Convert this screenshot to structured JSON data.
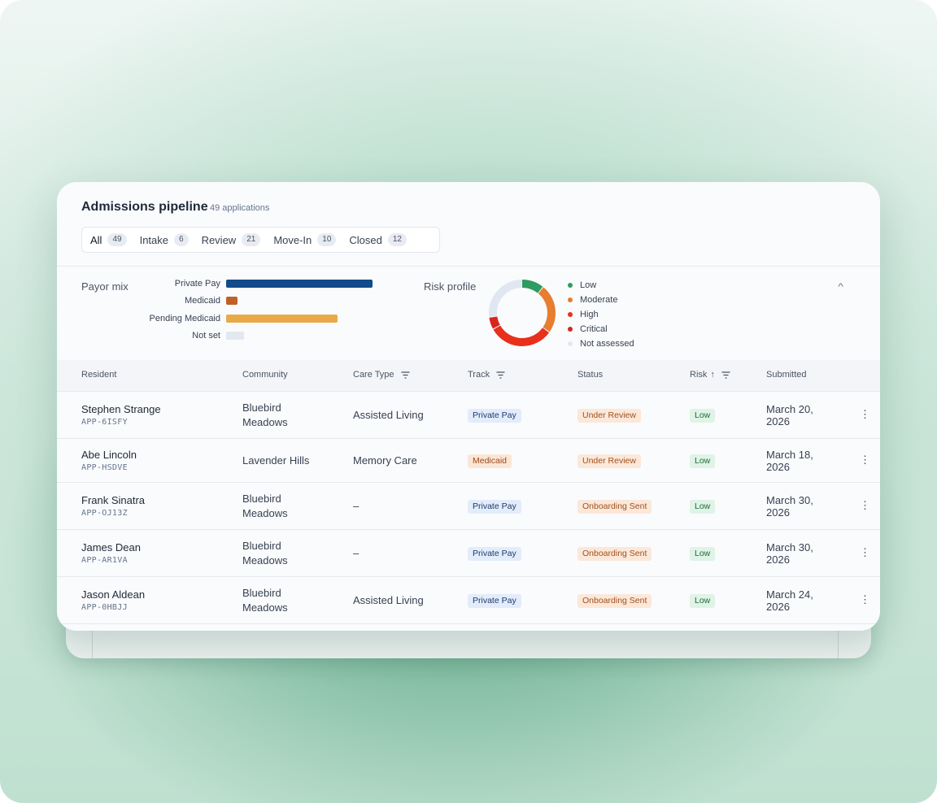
{
  "header": {
    "title": "Admissions pipeline",
    "count": "49 applications"
  },
  "tabs": [
    {
      "label": "All",
      "count": "49",
      "active": true
    },
    {
      "label": "Intake",
      "count": "6"
    },
    {
      "label": "Review",
      "count": "21"
    },
    {
      "label": "Move-In",
      "count": "10"
    },
    {
      "label": "Closed",
      "count": "12"
    }
  ],
  "payor": {
    "title": "Payor mix",
    "bars": [
      {
        "label": "Private Pay",
        "value": 1.0,
        "color": "#134a8a"
      },
      {
        "label": "Medicaid",
        "value": 0.08,
        "color": "#c25f26"
      },
      {
        "label": "Pending Medicaid",
        "value": 0.76,
        "color": "#eaa948"
      },
      {
        "label": "Not set",
        "value": 0.12,
        "color": "#e2e8f2"
      }
    ]
  },
  "risk": {
    "title": "Risk profile",
    "legend": [
      {
        "label": "Low",
        "color": "#2e9b60"
      },
      {
        "label": "Moderate",
        "color": "#e77d2e"
      },
      {
        "label": "High",
        "color": "#e8301c"
      },
      {
        "label": "Critical",
        "color": "#d9261c"
      },
      {
        "label": "Not assessed",
        "color": "#e1e7f1"
      }
    ],
    "segments": [
      0.11,
      0.24,
      0.32,
      0.06,
      0.27
    ]
  },
  "table": {
    "columns": {
      "resident": "Resident",
      "community": "Community",
      "care_type": "Care Type",
      "track": "Track",
      "status": "Status",
      "risk": "Risk",
      "submitted": "Submitted"
    },
    "rows": [
      {
        "name": "Stephen Strange",
        "id": "APP-6ISFY",
        "community_1": "Bluebird",
        "community_2": "Meadows",
        "care_type": "Assisted Living",
        "track": "Private Pay",
        "status": "Under Review",
        "risk": "Low",
        "date_1": "March 20,",
        "date_2": "2026"
      },
      {
        "name": "Abe Lincoln",
        "id": "APP-HSDVE",
        "community_1": "Lavender Hills",
        "community_2": "",
        "care_type": "Memory Care",
        "track": "Medicaid",
        "status": "Under Review",
        "risk": "Low",
        "date_1": "March 18,",
        "date_2": "2026"
      },
      {
        "name": "Frank Sinatra",
        "id": "APP-OJ13Z",
        "community_1": "Bluebird",
        "community_2": "Meadows",
        "care_type": "–",
        "track": "Private Pay",
        "status": "Onboarding Sent",
        "risk": "Low",
        "date_1": "March 30,",
        "date_2": "2026"
      },
      {
        "name": "James Dean",
        "id": "APP-AR1VA",
        "community_1": "Bluebird",
        "community_2": "Meadows",
        "care_type": "–",
        "track": "Private Pay",
        "status": "Onboarding Sent",
        "risk": "Low",
        "date_1": "March 30,",
        "date_2": "2026"
      },
      {
        "name": "Jason Aldean",
        "id": "APP-0HBJJ",
        "community_1": "Bluebird",
        "community_2": "Meadows",
        "care_type": "Assisted Living",
        "track": "Private Pay",
        "status": "Onboarding Sent",
        "risk": "Low",
        "date_1": "March 24,",
        "date_2": "2026"
      }
    ]
  },
  "icons": {
    "filter": "filter-icon",
    "sort": "sort-asc-icon",
    "more": "more-vertical-icon",
    "collapse": "chevron-up-icon"
  }
}
